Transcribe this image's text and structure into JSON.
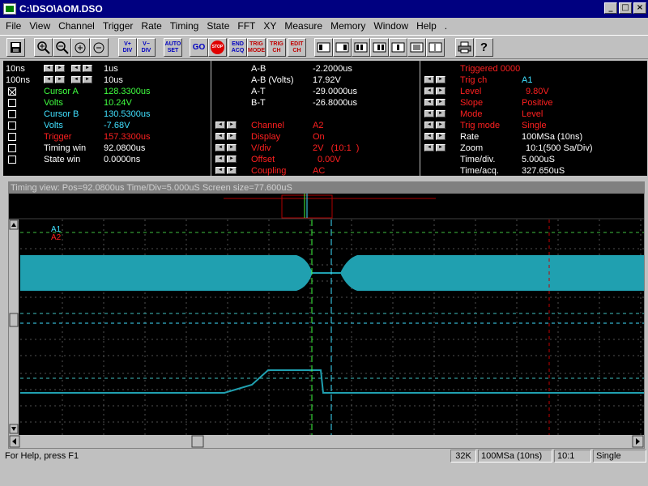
{
  "window": {
    "title": "C:\\DSO\\AOM.DSO",
    "min": "_",
    "max": "□",
    "close": "×"
  },
  "menu": [
    "File",
    "View",
    "Channel",
    "Trigger",
    "Rate",
    "Timing",
    "State",
    "FFT",
    "XY",
    "Measure",
    "Memory",
    "Window",
    "Help",
    "."
  ],
  "toolbar": {
    "save_icon": "floppy-icon",
    "zoom_in_icon": "zoom-in-icon",
    "zoom_out_icon": "zoom-out-icon",
    "vdiv_up": "V+\nDIV",
    "vdiv_down": "V−\nDIV",
    "auto_set": "AUTO\nSET",
    "go": "GO",
    "stop": "STOP",
    "end_acq": "END\nACQ",
    "trig_mode": "TRIG\nMODE",
    "trig_ch": "TRIG\nCH",
    "edit_ch": "EDIT\nCH",
    "print_icon": "printer-icon",
    "help_icon": "help-icon"
  },
  "info_left": {
    "time1": "10ns",
    "time1_val": "1us",
    "time2": "100ns",
    "time2_val": "10us",
    "cursor_a_label": "Cursor A",
    "cursor_a_val": "128.3300us",
    "volts_a_label": "Volts",
    "volts_a_val": "10.24V",
    "cursor_b_label": "Cursor B",
    "cursor_b_val": "130.5300us",
    "volts_b_label": "Volts",
    "volts_b_val": "-7.68V",
    "trigger_label": "Trigger",
    "trigger_val": "157.3300us",
    "timing_win_label": "Timing win",
    "timing_win_val": "92.0800us",
    "state_win_label": "State win",
    "state_win_val": "0.0000ns"
  },
  "info_mid": {
    "ab_label": "A-B",
    "ab_val": "-2.2000us",
    "abv_label": "A-B (Volts)",
    "abv_val": "17.92V",
    "at_label": "A-T",
    "at_val": "-29.0000us",
    "bt_label": "B-T",
    "bt_val": "-26.8000us",
    "channel_label": "Channel",
    "channel_val": "A2",
    "display_label": "Display",
    "display_val": "On",
    "vdiv_label": "V/div",
    "vdiv_val": "2V   (10:1  )",
    "offset_label": "Offset",
    "offset_val": "0.00V",
    "coupling_label": "Coupling",
    "coupling_val": "AC"
  },
  "info_right": {
    "triggered": "Triggered 0000",
    "trigch_label": "Trig ch",
    "trigch_val": "A1",
    "level_label": "Level",
    "level_val": "9.80V",
    "slope_label": "Slope",
    "slope_val": "Positive",
    "mode_label": "Mode",
    "mode_val": "Level",
    "trigmode_label": "Trig mode",
    "trigmode_val": "Single",
    "rate_label": "Rate",
    "rate_val": "100MSa (10ns)",
    "zoom_label": "Zoom",
    "zoom_val": "10:1(500 Sa/Div)",
    "timediv_label": "Time/div.",
    "timediv_val": "5.000uS",
    "timeacq_label": "Time/acq.",
    "timeacq_val": "327.650uS"
  },
  "scope": {
    "title": "Timing view: Pos=92.0800us Time/Div=5.000uS Screen size=77.600uS",
    "ch1_label": "A1",
    "ch2_label": "A2",
    "ch1_color": "#ff0000",
    "ch2_color": "#20a0b0"
  },
  "status": {
    "help": "For Help, press F1",
    "mem": "32K",
    "rate": "100MSa (10ns)",
    "zoom": "10:1",
    "mode": "Single"
  }
}
